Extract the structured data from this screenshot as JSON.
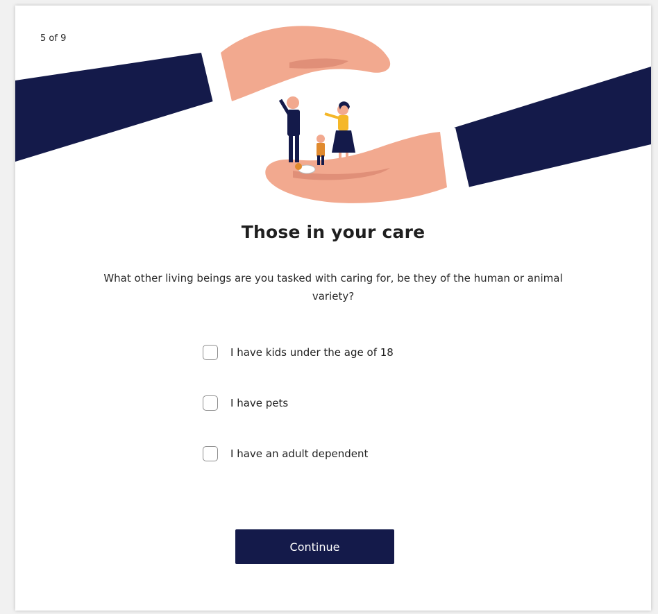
{
  "progress": {
    "text": "5 of 9"
  },
  "header": {
    "title": "Those in your care"
  },
  "question": {
    "text": "What other living beings are you tasked with caring for, be they of the human or animal variety?"
  },
  "options": [
    {
      "label": "I have kids under the age of 18",
      "checked": false
    },
    {
      "label": "I have pets",
      "checked": false
    },
    {
      "label": "I have an adult dependent",
      "checked": false
    }
  ],
  "actions": {
    "continue_label": "Continue"
  },
  "colors": {
    "navy": "#141a4a",
    "skin": "#f2a98f",
    "skin_shadow": "#e08f78",
    "cuff": "#ffffff",
    "accent_yellow": "#f5b728"
  },
  "illustration": {
    "icon": "hands-protecting-family-illustration"
  }
}
